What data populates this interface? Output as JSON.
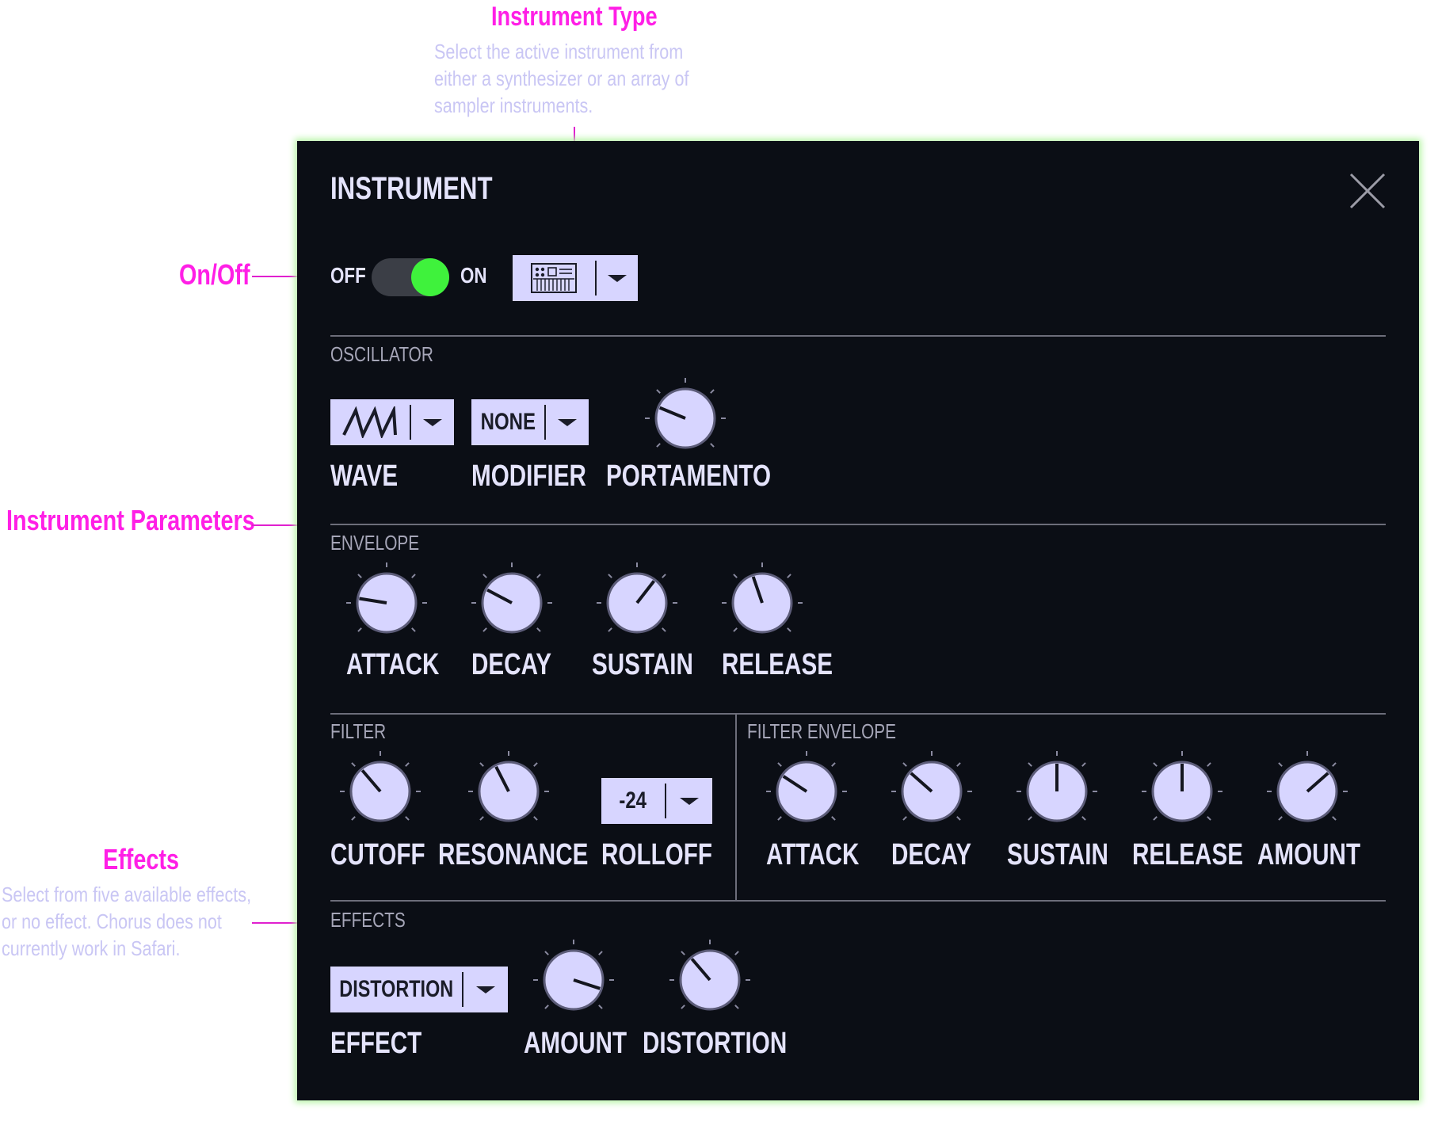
{
  "annotations": {
    "instrument_type": {
      "title": "Instrument Type",
      "desc": [
        "Select the active instrument from",
        "either a synthesizer or an array of",
        "sampler instruments."
      ]
    },
    "on_off": {
      "title": "On/Off"
    },
    "instrument_parameters": {
      "title": "Instrument Parameters"
    },
    "effects": {
      "title": "Effects",
      "desc": [
        "Select from five available effects,",
        "or no effect. Chorus does not",
        "currently work in Safari."
      ]
    }
  },
  "panel": {
    "title": "INSTRUMENT",
    "toggle": {
      "off_label": "OFF",
      "on_label": "ON",
      "state": "on"
    },
    "instrument_icon": "synth-keyboard-icon",
    "oscillator": {
      "section": "OSCILLATOR",
      "wave_icon": "sawtooth-wave-icon",
      "wave_label": "WAVE",
      "modifier_value": "NONE",
      "modifier_label": "MODIFIER",
      "portamento_label": "PORTAMENTO",
      "portamento_level": 0.25
    },
    "envelope": {
      "section": "ENVELOPE",
      "knobs": [
        {
          "label": "ATTACK",
          "level": 0.2
        },
        {
          "label": "DECAY",
          "level": 0.27
        },
        {
          "label": "SUSTAIN",
          "level": 0.64
        },
        {
          "label": "RELEASE",
          "level": 0.43
        }
      ]
    },
    "filter": {
      "section": "FILTER",
      "cutoff_label": "CUTOFF",
      "cutoff_level": 0.35,
      "resonance_label": "RESONANCE",
      "resonance_level": 0.4,
      "rolloff_value": "-24",
      "rolloff_label": "ROLLOFF"
    },
    "filter_envelope": {
      "section": "FILTER ENVELOPE",
      "knobs": [
        {
          "label": "ATTACK",
          "level": 0.29
        },
        {
          "label": "DECAY",
          "level": 0.32
        },
        {
          "label": "SUSTAIN",
          "level": 0.5
        },
        {
          "label": "RELEASE",
          "level": 0.5
        },
        {
          "label": "AMOUNT",
          "level": 0.68
        }
      ]
    },
    "effects": {
      "section": "EFFECTS",
      "effect_value": "DISTORTION",
      "effect_label": "EFFECT",
      "amount_label": "AMOUNT",
      "amount_level": 0.9,
      "distortion_label": "DISTORTION",
      "distortion_level": 0.35
    }
  },
  "colors": {
    "panel_bg": "#0b0e15",
    "accent_lavender": "#d7d5ff",
    "toggle_on": "#3ff23c",
    "annotation_magenta": "#ff1fe6",
    "panel_glow": "#b8f5a8"
  }
}
